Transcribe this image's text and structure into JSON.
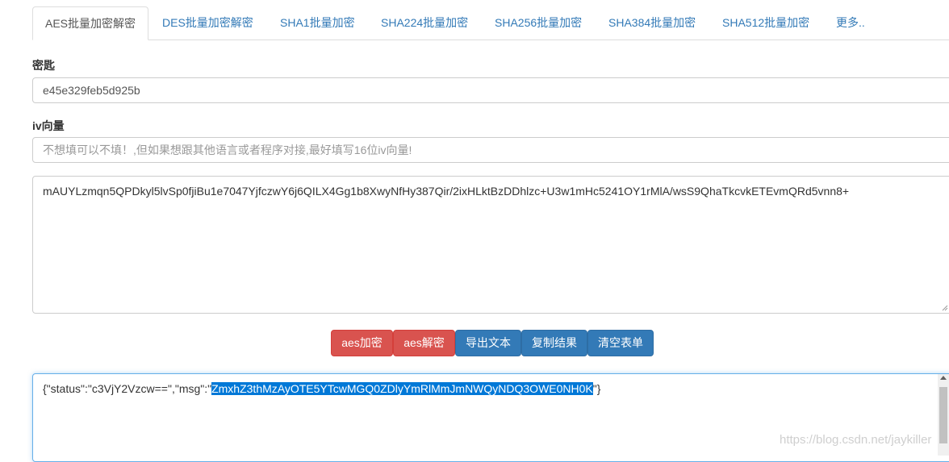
{
  "tabs": [
    {
      "label": "AES批量加密解密",
      "active": true
    },
    {
      "label": "DES批量加密解密"
    },
    {
      "label": "SHA1批量加密"
    },
    {
      "label": "SHA224批量加密"
    },
    {
      "label": "SHA256批量加密"
    },
    {
      "label": "SHA384批量加密"
    },
    {
      "label": "SHA512批量加密"
    },
    {
      "label": "更多.."
    }
  ],
  "form": {
    "key_label": "密匙",
    "key_value": "e45e329feb5d925b",
    "iv_label": "iv向量",
    "iv_placeholder": "不想填可以不填！,但如果想跟其他语言或者程序对接,最好填写16位iv向量!",
    "input_text": "mAUYLzmqn5QPDkyl5lvSp0fjiBu1e7047YjfczwY6j6QILX4Gg1b8XwyNfHy387Qir/2ixHLktBzDDhlzc+U3w1mHc5241OY1rMlA/wsS9QhaTkcvkETEvmQRd5vnn8+"
  },
  "buttons": {
    "encrypt": "aes加密",
    "decrypt": "aes解密",
    "export": "导出文本",
    "copy": "复制结果",
    "clear": "清空表单"
  },
  "output": {
    "prefix": "{\"status\":\"c3VjY2Vzcw==\",\"msg\":\"",
    "selected": "ZmxhZ3thMzAyOTE5YTcwMGQ0ZDlyYmRlMmJmNWQyNDQ3OWE0NH0K",
    "suffix": "\"}"
  },
  "watermark": "https://blog.csdn.net/jaykiller",
  "colors": {
    "link": "#337ab7",
    "danger": "#d9534f",
    "primary": "#337ab7",
    "selection": "#0078d7"
  }
}
